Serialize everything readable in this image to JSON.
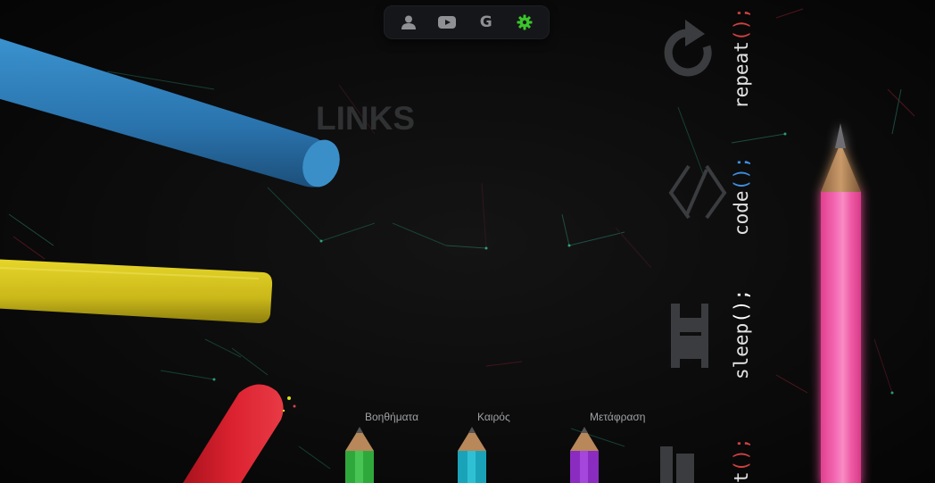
{
  "toolbar": {
    "buttons": [
      {
        "name": "user-icon"
      },
      {
        "name": "youtube-icon"
      },
      {
        "name": "google-icon",
        "glyph": "G"
      },
      {
        "name": "gear-icon",
        "color": "#3bc42a"
      }
    ]
  },
  "main": {
    "title": "LINKS"
  },
  "code_lines": [
    {
      "text": "repeat",
      "punct": "();"
    },
    {
      "text": "code",
      "punct": "();"
    },
    {
      "text": "sleep",
      "punct": "();"
    },
    {
      "text": "t",
      "punct": "();"
    }
  ],
  "pencil_links": [
    {
      "label": "Βοηθήματα",
      "color": "#2fa83b"
    },
    {
      "label": "Καιρός",
      "color": "#1aa3b8"
    },
    {
      "label": "Μετάφραση",
      "color": "#8a2cc0"
    }
  ],
  "colors": {
    "background": "#0b0b0b",
    "chalk_blue": "#2f7fb8",
    "chalk_yellow": "#d8c81e",
    "chalk_red": "#d21c28",
    "pink_pencil": "#f05aa8"
  }
}
